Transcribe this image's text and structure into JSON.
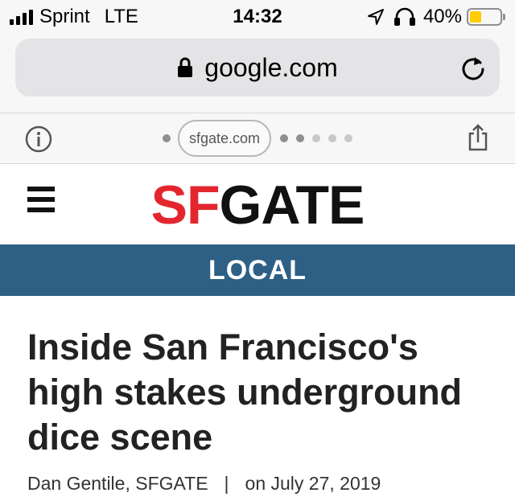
{
  "status_bar": {
    "carrier": "Sprint",
    "network": "LTE",
    "time": "14:32",
    "battery_percent": "40%",
    "battery_level": 0.4,
    "icons": [
      "signal-icon",
      "location-arrow-icon",
      "headphones-icon",
      "battery-icon"
    ]
  },
  "browser": {
    "url": "google.com",
    "amp_domain": "sfgate.com",
    "icons": [
      "lock-icon",
      "reload-icon",
      "info-icon",
      "share-icon"
    ]
  },
  "site": {
    "logo_red": "SF",
    "logo_black": "GATE",
    "section": "LOCAL",
    "colors": {
      "logo_red": "#e3262e",
      "section_band": "#2e6085",
      "battery": "#ffcc00"
    }
  },
  "article": {
    "headline": "Inside San Francisco's high stakes underground dice scene",
    "author": "Dan Gentile, SFGATE",
    "separator": "|",
    "date": "on July 27, 2019"
  }
}
